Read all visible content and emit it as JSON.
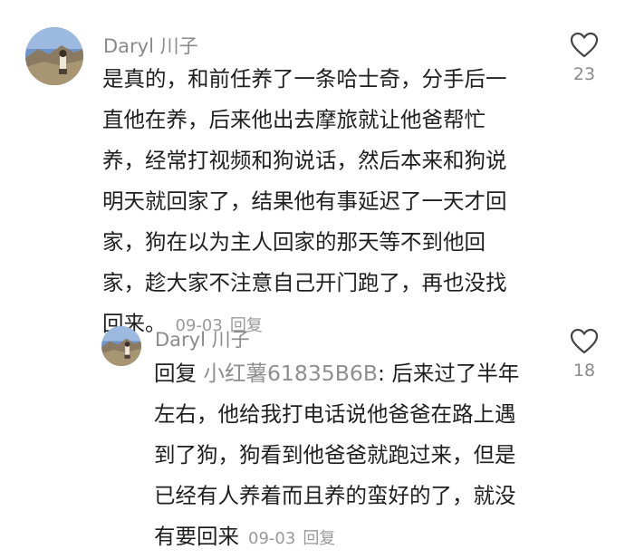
{
  "comments": [
    {
      "username": "Daryl 川子",
      "lines": [
        "是真的，和前任养了一条哈士奇，分手后一",
        "直他在养，后来他出去摩旅就让他爸帮忙",
        "养，经常打视频和狗说话，然后本来和狗说",
        "明天就回家了，结果他有事延迟了一天才回",
        "家，狗在以为主人回家的那天等不到他回",
        "家，趁大家不注意自己开门跑了，再也没找",
        "回来。"
      ],
      "date": "09-03",
      "reply_label": "回复",
      "likes": "23",
      "avatar_icon": "landscape-avatar",
      "like_icon": "heart-outline-icon"
    }
  ],
  "reply": {
    "username": "Daryl 川子",
    "prefix": "回复",
    "mention": "小红薯61835B6B",
    "first_line_rest": ": 后来过了半年",
    "lines": [
      "左右，他给我打电话说他爸爸在路上遇",
      "到了狗，狗看到他爸爸就跑过来，但是",
      "已经有人养着而且养的蛮好的了，就没",
      "有要回来"
    ],
    "date": "09-03",
    "reply_label": "回复",
    "likes": "18",
    "avatar_icon": "landscape-avatar",
    "like_icon": "heart-outline-icon"
  },
  "colors": {
    "text": "#1f1f1f",
    "muted": "#8a8a8a",
    "background": "#ffffff"
  }
}
